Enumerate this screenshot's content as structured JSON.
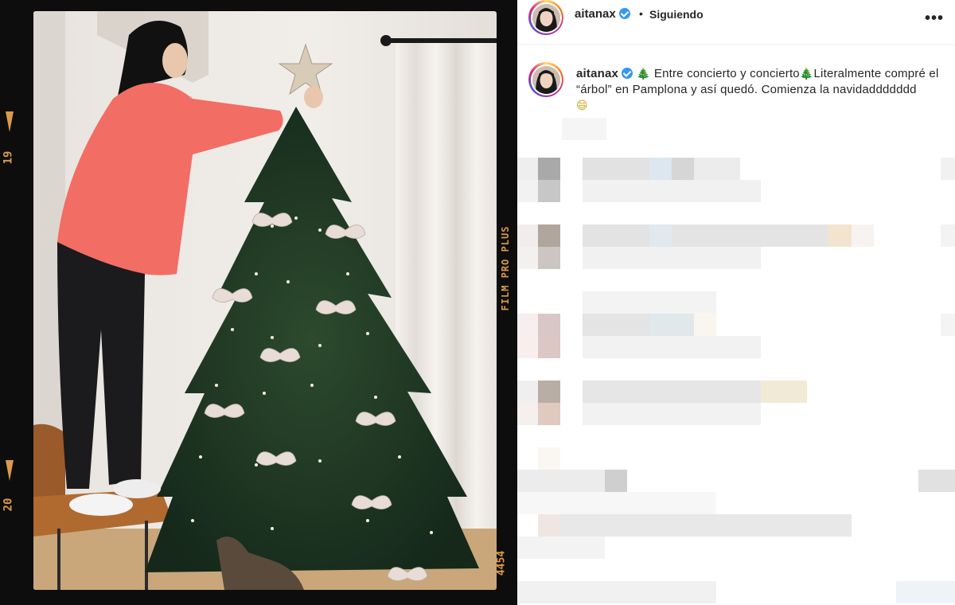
{
  "film": {
    "frame_number_top": "19",
    "frame_number_bottom": "20",
    "brand": "FILM PRO PLUS",
    "code": "4454"
  },
  "post": {
    "username": "aitanax",
    "separator": "•",
    "follow_status": "Siguiendo",
    "more_icon": "more-options-icon",
    "caption": {
      "username": "aitanax",
      "emoji_1": "🎄",
      "text_1": " Entre concierto y concierto",
      "emoji_2": "🎄",
      "text_2": "Literalmente compré el “árbol” en Pamplona y así quedó. Comienza la navidaddddddd",
      "emoji_3": "😄"
    }
  },
  "colors": {
    "verified_badge": "#3897f0",
    "film_text": "#d99a4a",
    "sweater": "#f26d64",
    "tree": "#1f3b22"
  }
}
